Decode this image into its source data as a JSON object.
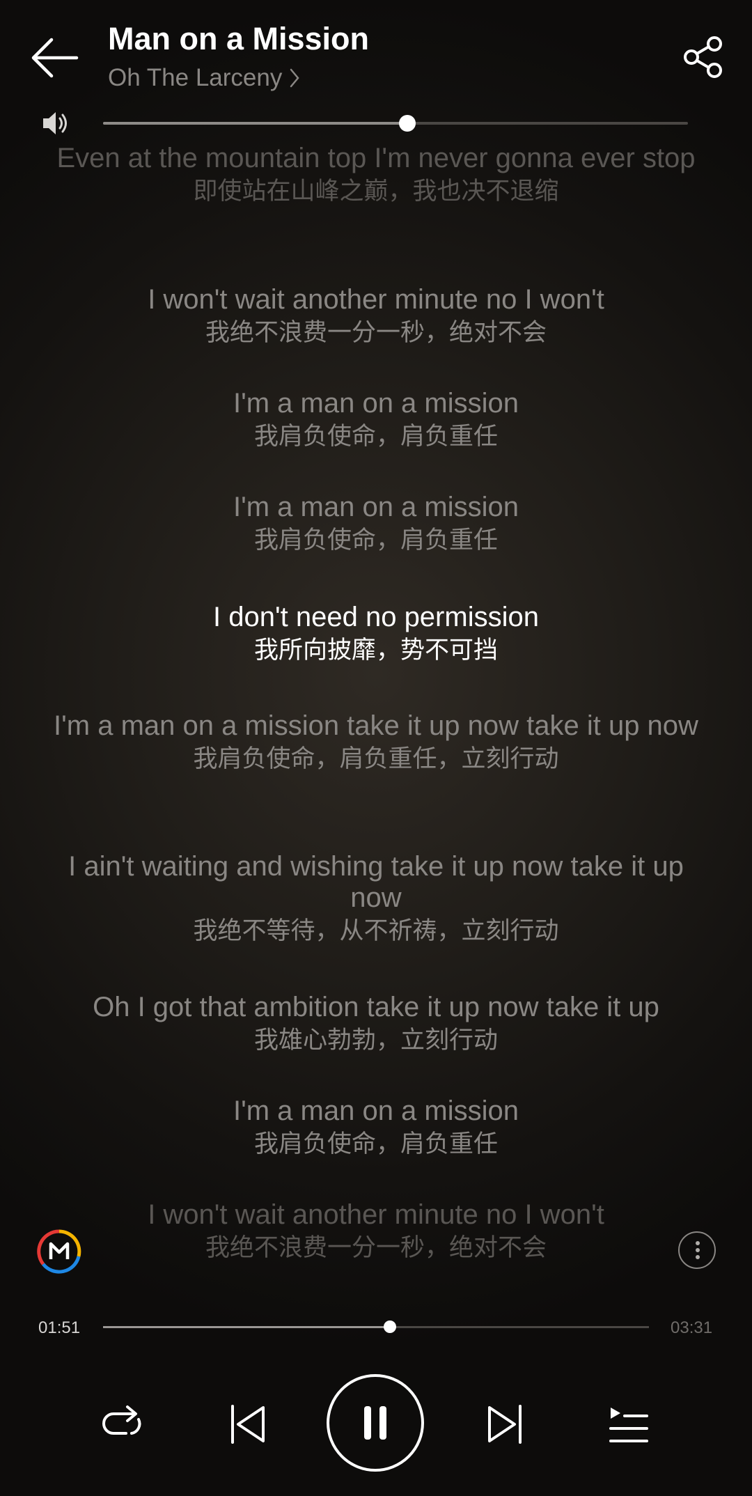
{
  "header": {
    "title": "Man on a Mission",
    "artist": "Oh The Larceny",
    "back_icon": "arrow-left-icon",
    "share_icon": "share-icon"
  },
  "volume": {
    "icon": "speaker-icon",
    "level": 0.52
  },
  "lyrics": [
    {
      "en": "Even at the mountain top I'm never gonna ever stop",
      "zh": "即使站在山峰之巅，我也决不退缩",
      "state": "past-faded"
    },
    {
      "en": "I won't wait another minute no I won't",
      "zh": "我绝不浪费一分一秒，绝对不会",
      "state": "past"
    },
    {
      "en": "I'm a man on a mission",
      "zh": "我肩负使命，肩负重任",
      "state": "past"
    },
    {
      "en": "I'm a man on a mission",
      "zh": "我肩负使命，肩负重任",
      "state": "past"
    },
    {
      "en": "I don't need no permission",
      "zh": "我所向披靡，势不可挡",
      "state": "current"
    },
    {
      "en": "I'm a man on a mission take it up now take it up now",
      "zh": "我肩负使命，肩负重任，立刻行动",
      "state": "upcoming"
    },
    {
      "en": "I ain't waiting and wishing take it up now take it up now",
      "zh": "我绝不等待，从不祈祷，立刻行动",
      "state": "upcoming"
    },
    {
      "en": "Oh I got that ambition take it up now take it up",
      "zh": "我雄心勃勃，立刻行动",
      "state": "upcoming"
    },
    {
      "en": "I'm a man on a mission",
      "zh": "我肩负使命，肩负重任",
      "state": "upcoming"
    },
    {
      "en": "I won't wait another minute no I won't",
      "zh": "我绝不浪费一分一秒，绝对不会",
      "state": "upcoming-faded"
    }
  ],
  "logo": {
    "icon": "m-logo-icon",
    "letter": "M"
  },
  "more": {
    "icon": "more-vertical-icon"
  },
  "progress": {
    "current": "01:51",
    "total": "03:31",
    "fraction": 0.526
  },
  "controls": {
    "repeat_icon": "repeat-icon",
    "prev_icon": "skip-previous-icon",
    "play_icon": "pause-icon",
    "next_icon": "skip-next-icon",
    "playlist_icon": "playlist-icon"
  },
  "colors": {
    "text_active": "#ffffff",
    "text_inactive": "#8a8784",
    "logo_ring": [
      "#f5b400",
      "#e53935",
      "#1e88e5"
    ]
  }
}
